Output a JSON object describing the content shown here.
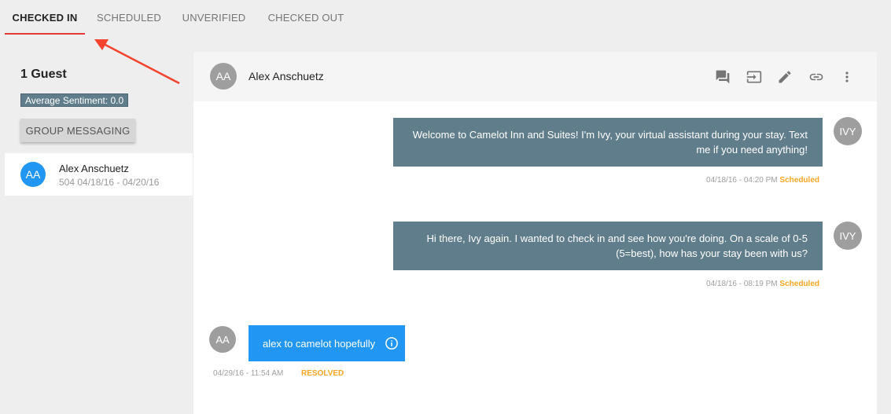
{
  "tabs": [
    {
      "label": "CHECKED IN",
      "active": true
    },
    {
      "label": "SCHEDULED",
      "active": false
    },
    {
      "label": "UNVERIFIED",
      "active": false
    },
    {
      "label": "CHECKED OUT",
      "active": false
    }
  ],
  "sidebar": {
    "guest_count": "1 Guest",
    "sentiment": "Average Sentiment: 0.0",
    "group_button": "GROUP MESSAGING",
    "guests": [
      {
        "initials": "AA",
        "name": "Alex Anschuetz",
        "meta": "504 04/18/16 - 04/20/16"
      }
    ]
  },
  "conversation": {
    "header": {
      "initials": "AA",
      "name": "Alex Anschuetz",
      "icons": [
        "chat-icon",
        "transfer-icon",
        "edit-icon",
        "link-icon",
        "more-vert-icon"
      ]
    },
    "messages": [
      {
        "direction": "outgoing",
        "avatar": "IVY",
        "text": "Welcome to Camelot Inn and Suites! I'm Ivy, your virtual assistant during your stay. Text me if you need anything!",
        "timestamp": "04/18/16 - 04:20 PM",
        "status": "Scheduled"
      },
      {
        "direction": "outgoing",
        "avatar": "IVY",
        "text": "Hi there, Ivy again. I wanted to check in and see how you're doing. On a scale of 0-5 (5=best), how has your stay been with us?",
        "timestamp": "04/18/16 - 08:19 PM",
        "status": "Scheduled"
      },
      {
        "direction": "incoming",
        "avatar": "AA",
        "text": "alex to camelot hopefully",
        "timestamp": "04/29/16 - 11:54 AM",
        "status": "RESOLVED"
      }
    ]
  },
  "colors": {
    "accent": "#e53935",
    "outgoing_bubble": "#607d8b",
    "incoming_bubble": "#2196f3",
    "status": "#f5a623"
  }
}
